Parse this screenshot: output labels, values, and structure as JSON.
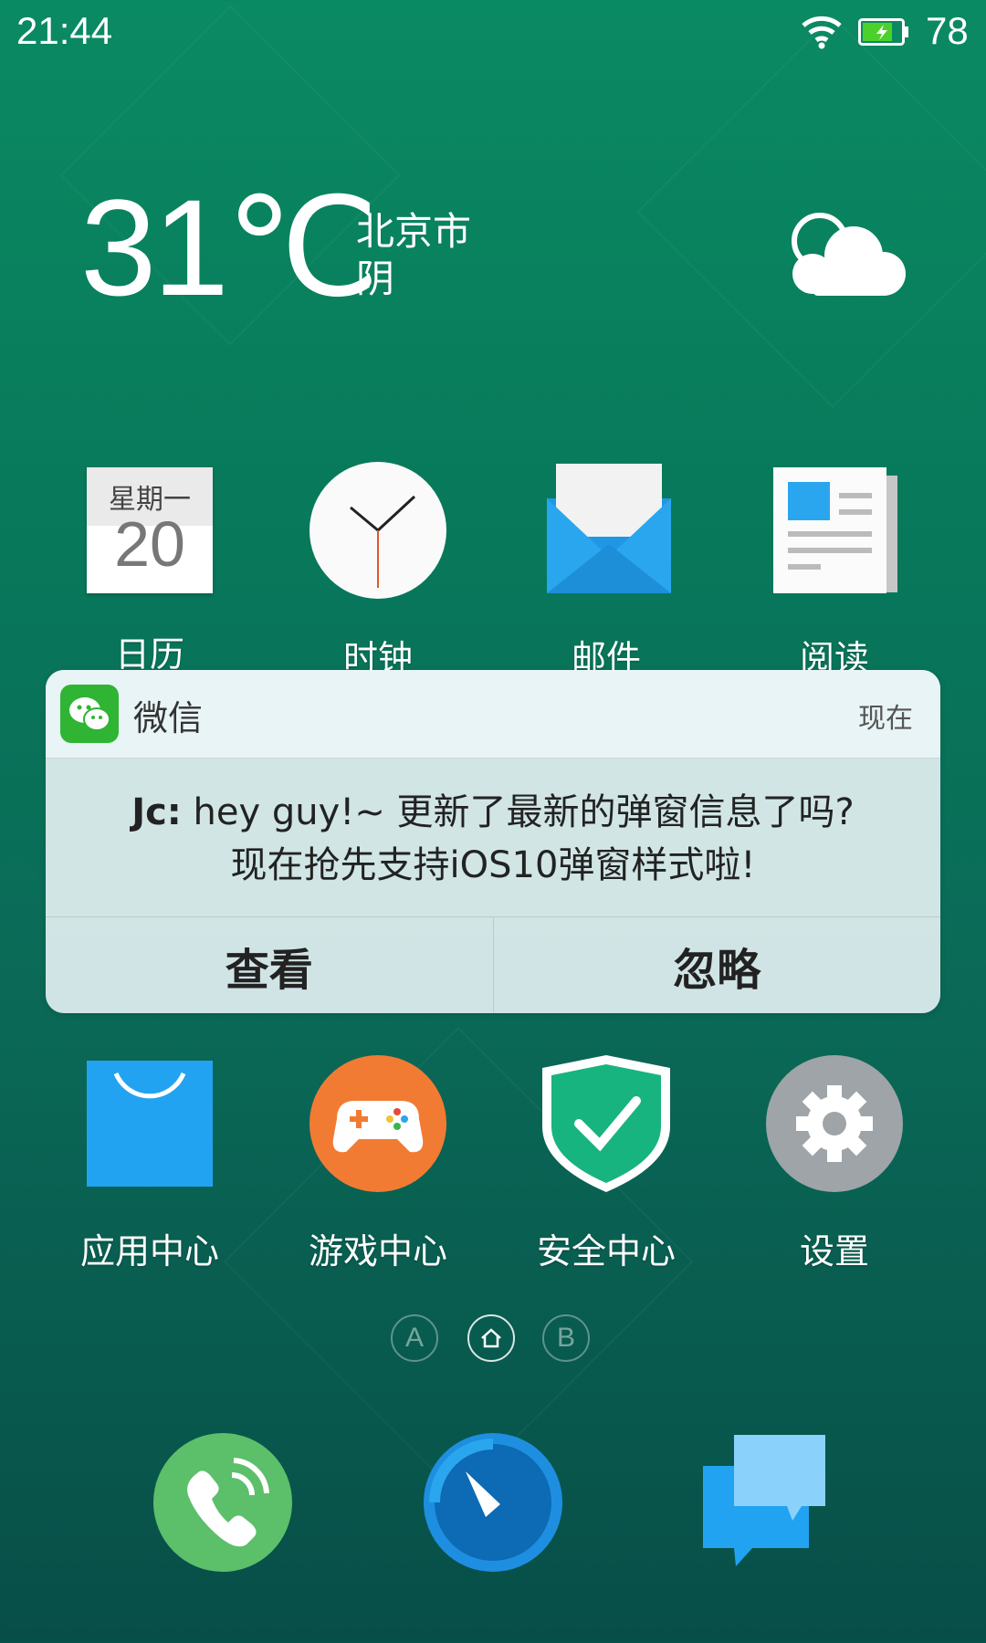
{
  "status_bar": {
    "time": "21:44",
    "battery_percent": "78",
    "battery_color": "#4cd02c"
  },
  "weather": {
    "temperature": "31℃",
    "city": "北京市",
    "condition": "阴",
    "icon": "cloud-icon"
  },
  "apps_row1": [
    {
      "label": "日历",
      "icon": "calendar-icon",
      "weekday": "星期一",
      "day": "20"
    },
    {
      "label": "时钟",
      "icon": "clock-icon"
    },
    {
      "label": "邮件",
      "icon": "mail-icon"
    },
    {
      "label": "阅读",
      "icon": "reader-icon"
    }
  ],
  "apps_row2": [
    {
      "label": "应用中心",
      "icon": "app-store-icon"
    },
    {
      "label": "游戏中心",
      "icon": "game-center-icon"
    },
    {
      "label": "安全中心",
      "icon": "security-shield-icon"
    },
    {
      "label": "设置",
      "icon": "settings-gear-icon"
    }
  ],
  "notification": {
    "app_name": "微信",
    "time": "现在",
    "sender": "Jc:",
    "line1": "hey guy!~ 更新了最新的弹窗信息了吗?",
    "line2": "现在抢先支持iOS10弹窗样式啦!",
    "view_label": "查看",
    "ignore_label": "忽略",
    "app_color": "#2fb533"
  },
  "page_indicator": {
    "left": "A",
    "right": "B"
  },
  "dock": [
    {
      "icon": "phone-icon"
    },
    {
      "icon": "browser-compass-icon"
    },
    {
      "icon": "messages-icon"
    }
  ]
}
